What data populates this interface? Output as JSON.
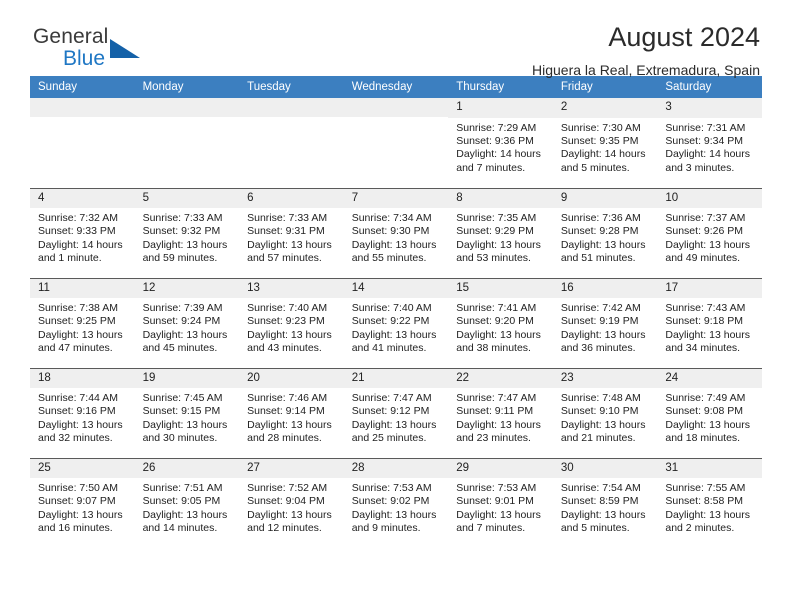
{
  "brand": {
    "name_primary": "General",
    "name_secondary": "Blue"
  },
  "header": {
    "title": "August 2024",
    "subtitle": "Higuera la Real, Extremadura, Spain"
  },
  "colors": {
    "header_blue": "#3c7fc0",
    "brand_blue": "#1f77c4",
    "triangle_blue": "#1461a8",
    "daynum_bg": "#efefef",
    "row_border": "#5a5a5a"
  },
  "weekday_headers": [
    "Sunday",
    "Monday",
    "Tuesday",
    "Wednesday",
    "Thursday",
    "Friday",
    "Saturday"
  ],
  "labels": {
    "sunrise": "Sunrise:",
    "sunset": "Sunset:",
    "daylight": "Daylight:"
  },
  "weeks": [
    [
      {
        "day": "",
        "empty": true
      },
      {
        "day": "",
        "empty": true
      },
      {
        "day": "",
        "empty": true
      },
      {
        "day": "",
        "empty": true
      },
      {
        "day": "1",
        "sunrise": "Sunrise: 7:29 AM",
        "sunset": "Sunset: 9:36 PM",
        "daylight": "Daylight: 14 hours and 7 minutes."
      },
      {
        "day": "2",
        "sunrise": "Sunrise: 7:30 AM",
        "sunset": "Sunset: 9:35 PM",
        "daylight": "Daylight: 14 hours and 5 minutes."
      },
      {
        "day": "3",
        "sunrise": "Sunrise: 7:31 AM",
        "sunset": "Sunset: 9:34 PM",
        "daylight": "Daylight: 14 hours and 3 minutes."
      }
    ],
    [
      {
        "day": "4",
        "sunrise": "Sunrise: 7:32 AM",
        "sunset": "Sunset: 9:33 PM",
        "daylight": "Daylight: 14 hours and 1 minute."
      },
      {
        "day": "5",
        "sunrise": "Sunrise: 7:33 AM",
        "sunset": "Sunset: 9:32 PM",
        "daylight": "Daylight: 13 hours and 59 minutes."
      },
      {
        "day": "6",
        "sunrise": "Sunrise: 7:33 AM",
        "sunset": "Sunset: 9:31 PM",
        "daylight": "Daylight: 13 hours and 57 minutes."
      },
      {
        "day": "7",
        "sunrise": "Sunrise: 7:34 AM",
        "sunset": "Sunset: 9:30 PM",
        "daylight": "Daylight: 13 hours and 55 minutes."
      },
      {
        "day": "8",
        "sunrise": "Sunrise: 7:35 AM",
        "sunset": "Sunset: 9:29 PM",
        "daylight": "Daylight: 13 hours and 53 minutes."
      },
      {
        "day": "9",
        "sunrise": "Sunrise: 7:36 AM",
        "sunset": "Sunset: 9:28 PM",
        "daylight": "Daylight: 13 hours and 51 minutes."
      },
      {
        "day": "10",
        "sunrise": "Sunrise: 7:37 AM",
        "sunset": "Sunset: 9:26 PM",
        "daylight": "Daylight: 13 hours and 49 minutes."
      }
    ],
    [
      {
        "day": "11",
        "sunrise": "Sunrise: 7:38 AM",
        "sunset": "Sunset: 9:25 PM",
        "daylight": "Daylight: 13 hours and 47 minutes."
      },
      {
        "day": "12",
        "sunrise": "Sunrise: 7:39 AM",
        "sunset": "Sunset: 9:24 PM",
        "daylight": "Daylight: 13 hours and 45 minutes."
      },
      {
        "day": "13",
        "sunrise": "Sunrise: 7:40 AM",
        "sunset": "Sunset: 9:23 PM",
        "daylight": "Daylight: 13 hours and 43 minutes."
      },
      {
        "day": "14",
        "sunrise": "Sunrise: 7:40 AM",
        "sunset": "Sunset: 9:22 PM",
        "daylight": "Daylight: 13 hours and 41 minutes."
      },
      {
        "day": "15",
        "sunrise": "Sunrise: 7:41 AM",
        "sunset": "Sunset: 9:20 PM",
        "daylight": "Daylight: 13 hours and 38 minutes."
      },
      {
        "day": "16",
        "sunrise": "Sunrise: 7:42 AM",
        "sunset": "Sunset: 9:19 PM",
        "daylight": "Daylight: 13 hours and 36 minutes."
      },
      {
        "day": "17",
        "sunrise": "Sunrise: 7:43 AM",
        "sunset": "Sunset: 9:18 PM",
        "daylight": "Daylight: 13 hours and 34 minutes."
      }
    ],
    [
      {
        "day": "18",
        "sunrise": "Sunrise: 7:44 AM",
        "sunset": "Sunset: 9:16 PM",
        "daylight": "Daylight: 13 hours and 32 minutes."
      },
      {
        "day": "19",
        "sunrise": "Sunrise: 7:45 AM",
        "sunset": "Sunset: 9:15 PM",
        "daylight": "Daylight: 13 hours and 30 minutes."
      },
      {
        "day": "20",
        "sunrise": "Sunrise: 7:46 AM",
        "sunset": "Sunset: 9:14 PM",
        "daylight": "Daylight: 13 hours and 28 minutes."
      },
      {
        "day": "21",
        "sunrise": "Sunrise: 7:47 AM",
        "sunset": "Sunset: 9:12 PM",
        "daylight": "Daylight: 13 hours and 25 minutes."
      },
      {
        "day": "22",
        "sunrise": "Sunrise: 7:47 AM",
        "sunset": "Sunset: 9:11 PM",
        "daylight": "Daylight: 13 hours and 23 minutes."
      },
      {
        "day": "23",
        "sunrise": "Sunrise: 7:48 AM",
        "sunset": "Sunset: 9:10 PM",
        "daylight": "Daylight: 13 hours and 21 minutes."
      },
      {
        "day": "24",
        "sunrise": "Sunrise: 7:49 AM",
        "sunset": "Sunset: 9:08 PM",
        "daylight": "Daylight: 13 hours and 18 minutes."
      }
    ],
    [
      {
        "day": "25",
        "sunrise": "Sunrise: 7:50 AM",
        "sunset": "Sunset: 9:07 PM",
        "daylight": "Daylight: 13 hours and 16 minutes."
      },
      {
        "day": "26",
        "sunrise": "Sunrise: 7:51 AM",
        "sunset": "Sunset: 9:05 PM",
        "daylight": "Daylight: 13 hours and 14 minutes."
      },
      {
        "day": "27",
        "sunrise": "Sunrise: 7:52 AM",
        "sunset": "Sunset: 9:04 PM",
        "daylight": "Daylight: 13 hours and 12 minutes."
      },
      {
        "day": "28",
        "sunrise": "Sunrise: 7:53 AM",
        "sunset": "Sunset: 9:02 PM",
        "daylight": "Daylight: 13 hours and 9 minutes."
      },
      {
        "day": "29",
        "sunrise": "Sunrise: 7:53 AM",
        "sunset": "Sunset: 9:01 PM",
        "daylight": "Daylight: 13 hours and 7 minutes."
      },
      {
        "day": "30",
        "sunrise": "Sunrise: 7:54 AM",
        "sunset": "Sunset: 8:59 PM",
        "daylight": "Daylight: 13 hours and 5 minutes."
      },
      {
        "day": "31",
        "sunrise": "Sunrise: 7:55 AM",
        "sunset": "Sunset: 8:58 PM",
        "daylight": "Daylight: 13 hours and 2 minutes."
      }
    ]
  ]
}
